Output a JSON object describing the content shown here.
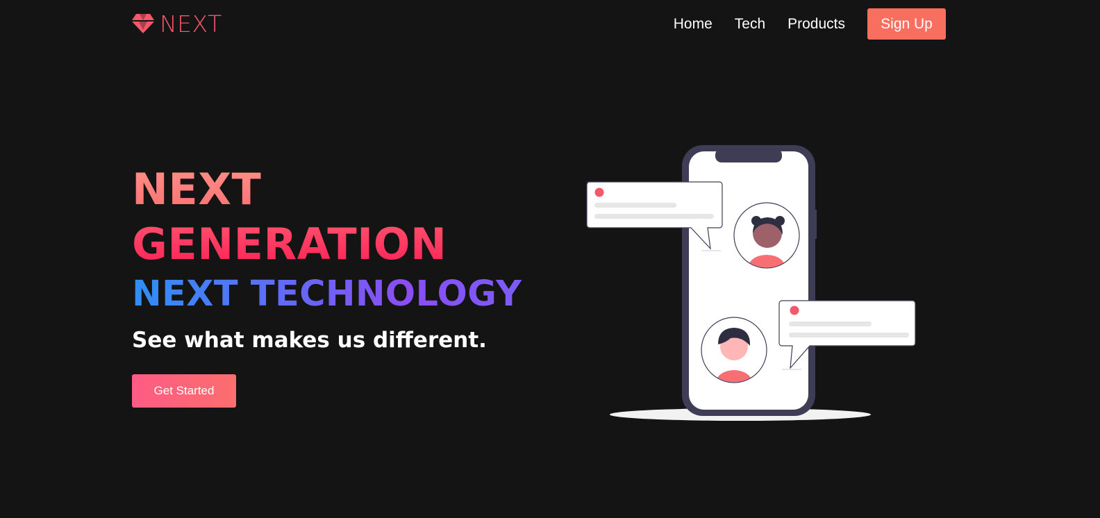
{
  "brand": {
    "name": "NEXT",
    "icon": "diamond-icon",
    "color": "#f7576b"
  },
  "nav": {
    "links": [
      "Home",
      "Tech",
      "Products"
    ],
    "signup_label": "Sign Up",
    "signup_color": "#f86f60"
  },
  "hero": {
    "line1": "NEXT",
    "line2": "GENERATION",
    "line3": "NEXT TECHNOLOGY",
    "subtitle": "See what makes us different.",
    "cta_label": "Get Started"
  },
  "illustration": {
    "icon": "phone-chat-illustration"
  },
  "colors": {
    "background": "#141414",
    "accent_red": "#fe2456",
    "accent_coral": "#fb7274",
    "tech_gradient_start": "#2e8ff8",
    "tech_gradient_end": "#8a4ef4"
  }
}
